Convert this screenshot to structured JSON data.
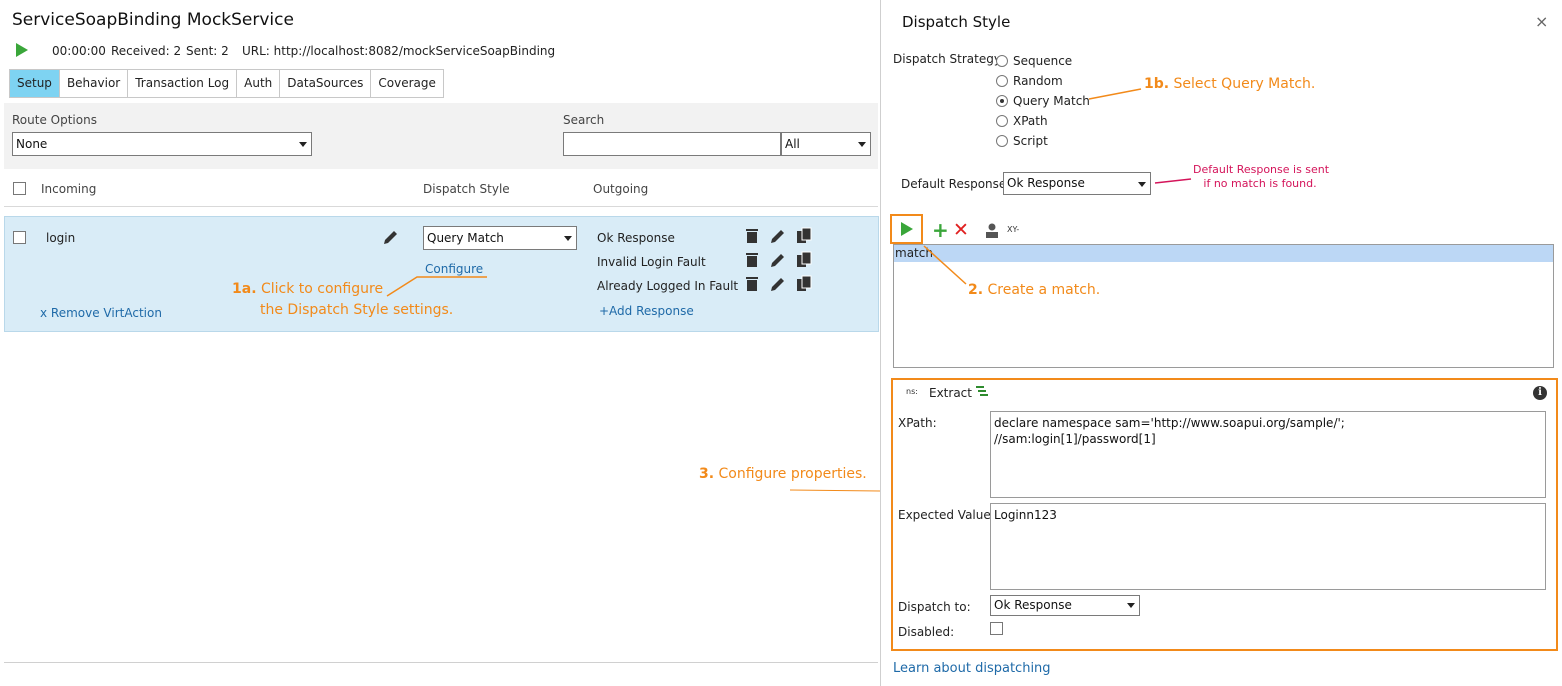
{
  "service": {
    "title": "ServiceSoapBinding MockService",
    "time": "00:00:00",
    "received": "Received: 2",
    "sent": "Sent: 2",
    "url": "URL: http://localhost:8082/mockServiceSoapBinding"
  },
  "tabs": [
    "Setup",
    "Behavior",
    "Transaction Log",
    "Auth",
    "DataSources",
    "Coverage"
  ],
  "route": {
    "label": "Route Options",
    "value": "None"
  },
  "search": {
    "label": "Search",
    "value": "",
    "filter": "All"
  },
  "columns": {
    "incoming": "Incoming",
    "dispatch": "Dispatch Style",
    "outgoing": "Outgoing"
  },
  "row": {
    "name": "login",
    "dispatch": "Query Match",
    "configure": "Configure",
    "remove": "x Remove VirtAction",
    "responses": [
      "Ok Response",
      "Invalid Login Fault",
      "Already Logged In Fault"
    ],
    "add_response": "+Add Response"
  },
  "annotations": {
    "a1_num": "1a.",
    "a1_line1": "Click to configure",
    "a1_line2": "the Dispatch Style settings.",
    "a1b_num": "1b.",
    "a1b_text": "Select Query Match.",
    "a2_num": "2.",
    "a2_text": "Create a match.",
    "a3_num": "3.",
    "a3_text": "Configure properties.",
    "default_note_line1": "Default Response is sent",
    "default_note_line2": "if no match is found."
  },
  "dispatch_panel": {
    "title": "Dispatch Style",
    "close": "×",
    "strategy_label": "Dispatch Strategy:",
    "strategies": [
      "Sequence",
      "Random",
      "Query Match",
      "XPath",
      "Script"
    ],
    "selected_strategy": "Query Match",
    "default_response_label": "Default Response:",
    "default_response": "Ok Response",
    "toolbar_xy": "XY-",
    "match_item": "match",
    "ns_label": "ns:",
    "extract_label": "Extract",
    "xpath_label": "XPath:",
    "xpath_value": "declare namespace sam='http://www.soapui.org/sample/';\n//sam:login[1]/password[1]",
    "expected_label": "Expected Value:",
    "expected_value": "Loginn123",
    "dispatch_to_label": "Dispatch to:",
    "dispatch_to": "Ok Response",
    "disabled_label": "Disabled:",
    "learn_link": "Learn about dispatching"
  },
  "colors": {
    "accent_tab": "#7ed3f2",
    "row_band": "#d9ecf7",
    "annotation": "#f28a1a",
    "note": "#d4145a",
    "play": "#3aa63a",
    "add": "#3aa63a",
    "delete": "#e02020",
    "link": "#1f6aa8"
  }
}
